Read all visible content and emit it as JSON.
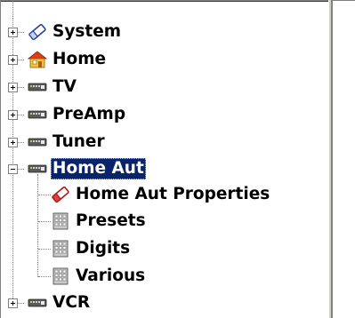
{
  "tree": {
    "nodes": [
      {
        "label": "System",
        "icon": "eraser-icon",
        "expander": "plus"
      },
      {
        "label": "Home",
        "icon": "house-icon",
        "expander": "plus"
      },
      {
        "label": "TV",
        "icon": "remote-icon",
        "expander": "plus"
      },
      {
        "label": "PreAmp",
        "icon": "remote-icon",
        "expander": "plus"
      },
      {
        "label": "Tuner",
        "icon": "remote-icon",
        "expander": "plus"
      },
      {
        "label": "Home Aut",
        "icon": "remote-icon",
        "expander": "minus",
        "selected": true,
        "children": [
          {
            "label": "Home Aut Properties",
            "icon": "eraser-icon"
          },
          {
            "label": "Presets",
            "icon": "grid-icon"
          },
          {
            "label": "Digits",
            "icon": "grid-icon"
          },
          {
            "label": "Various",
            "icon": "grid-icon"
          }
        ]
      },
      {
        "label": "VCR",
        "icon": "remote-icon",
        "expander": "plus"
      }
    ]
  },
  "colors": {
    "selection_bg": "#0a246a",
    "selection_text": "#ffffff",
    "tree_lines": "#808080",
    "splitter": "#d4d0c8"
  }
}
